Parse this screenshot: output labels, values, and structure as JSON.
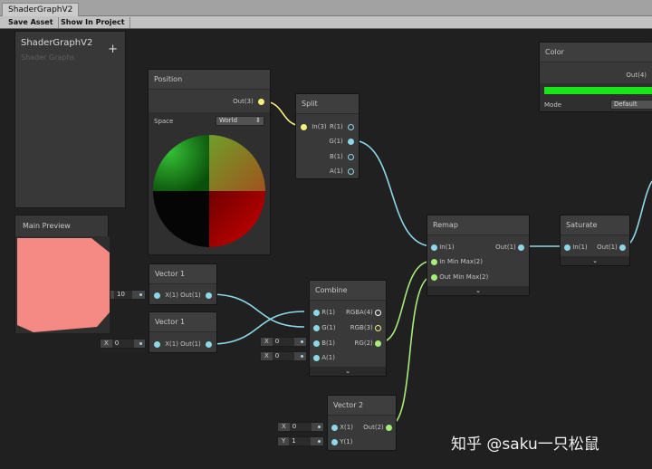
{
  "window": {
    "tab_label": "ShaderGraphV2"
  },
  "toolbar": {
    "save_label": "Save Asset",
    "show_label": "Show In Project"
  },
  "blackboard": {
    "title": "ShaderGraphV2",
    "subtitle": "Shader Graphs",
    "add_glyph": "+"
  },
  "main_preview": {
    "title": "Main Preview",
    "color": "#f58a85"
  },
  "nodes": {
    "position": {
      "title": "Position",
      "out_label": "Out(3)",
      "space_label": "Space",
      "space_value": "World",
      "dropdown_glyph": "⇕"
    },
    "split": {
      "title": "Split",
      "in_label": "In(3)",
      "outputs": [
        "R(1)",
        "G(1)",
        "B(1)",
        "A(1)"
      ]
    },
    "vector1a": {
      "title": "Vector 1",
      "in_label": "X(1)",
      "out_label": "Out(1)",
      "value": "10"
    },
    "vector1b": {
      "title": "Vector 1",
      "in_label": "X(1)",
      "out_label": "Out(1)",
      "value_label": "X",
      "value": "0"
    },
    "combine": {
      "title": "Combine",
      "inputs": [
        "R(1)",
        "G(1)",
        "B(1)",
        "A(1)"
      ],
      "outputs": [
        "RGBA(4)",
        "RGB(3)",
        "RG(2)"
      ],
      "b_input": {
        "label": "X",
        "value": "0"
      },
      "a_input": {
        "label": "X",
        "value": "0"
      },
      "expand_glyph": "⌄"
    },
    "remap": {
      "title": "Remap",
      "inputs": [
        "In(1)",
        "In Min Max(2)",
        "Out Min Max(2)"
      ],
      "out_label": "Out(1)",
      "expand_glyph": "⌄"
    },
    "saturate": {
      "title": "Saturate",
      "in_label": "In(1)",
      "out_label": "Out(1)",
      "expand_glyph": "⌄"
    },
    "vector2": {
      "title": "Vector 2",
      "inputs": [
        "X(1)",
        "Y(1)"
      ],
      "out_label": "Out(2)",
      "x_input": {
        "label": "X",
        "value": "0"
      },
      "y_input": {
        "label": "Y",
        "value": "1"
      }
    },
    "color": {
      "title": "Color",
      "out_label": "Out(4)",
      "swatch": "#19e619",
      "mode_label": "Mode",
      "mode_value": "Default"
    }
  },
  "colors": {
    "wire_float": "#8cd8e8",
    "wire_vec3": "#f6f07c",
    "wire_vec2": "#a6ee7a"
  },
  "watermark": "知乎 @saku一只松鼠"
}
